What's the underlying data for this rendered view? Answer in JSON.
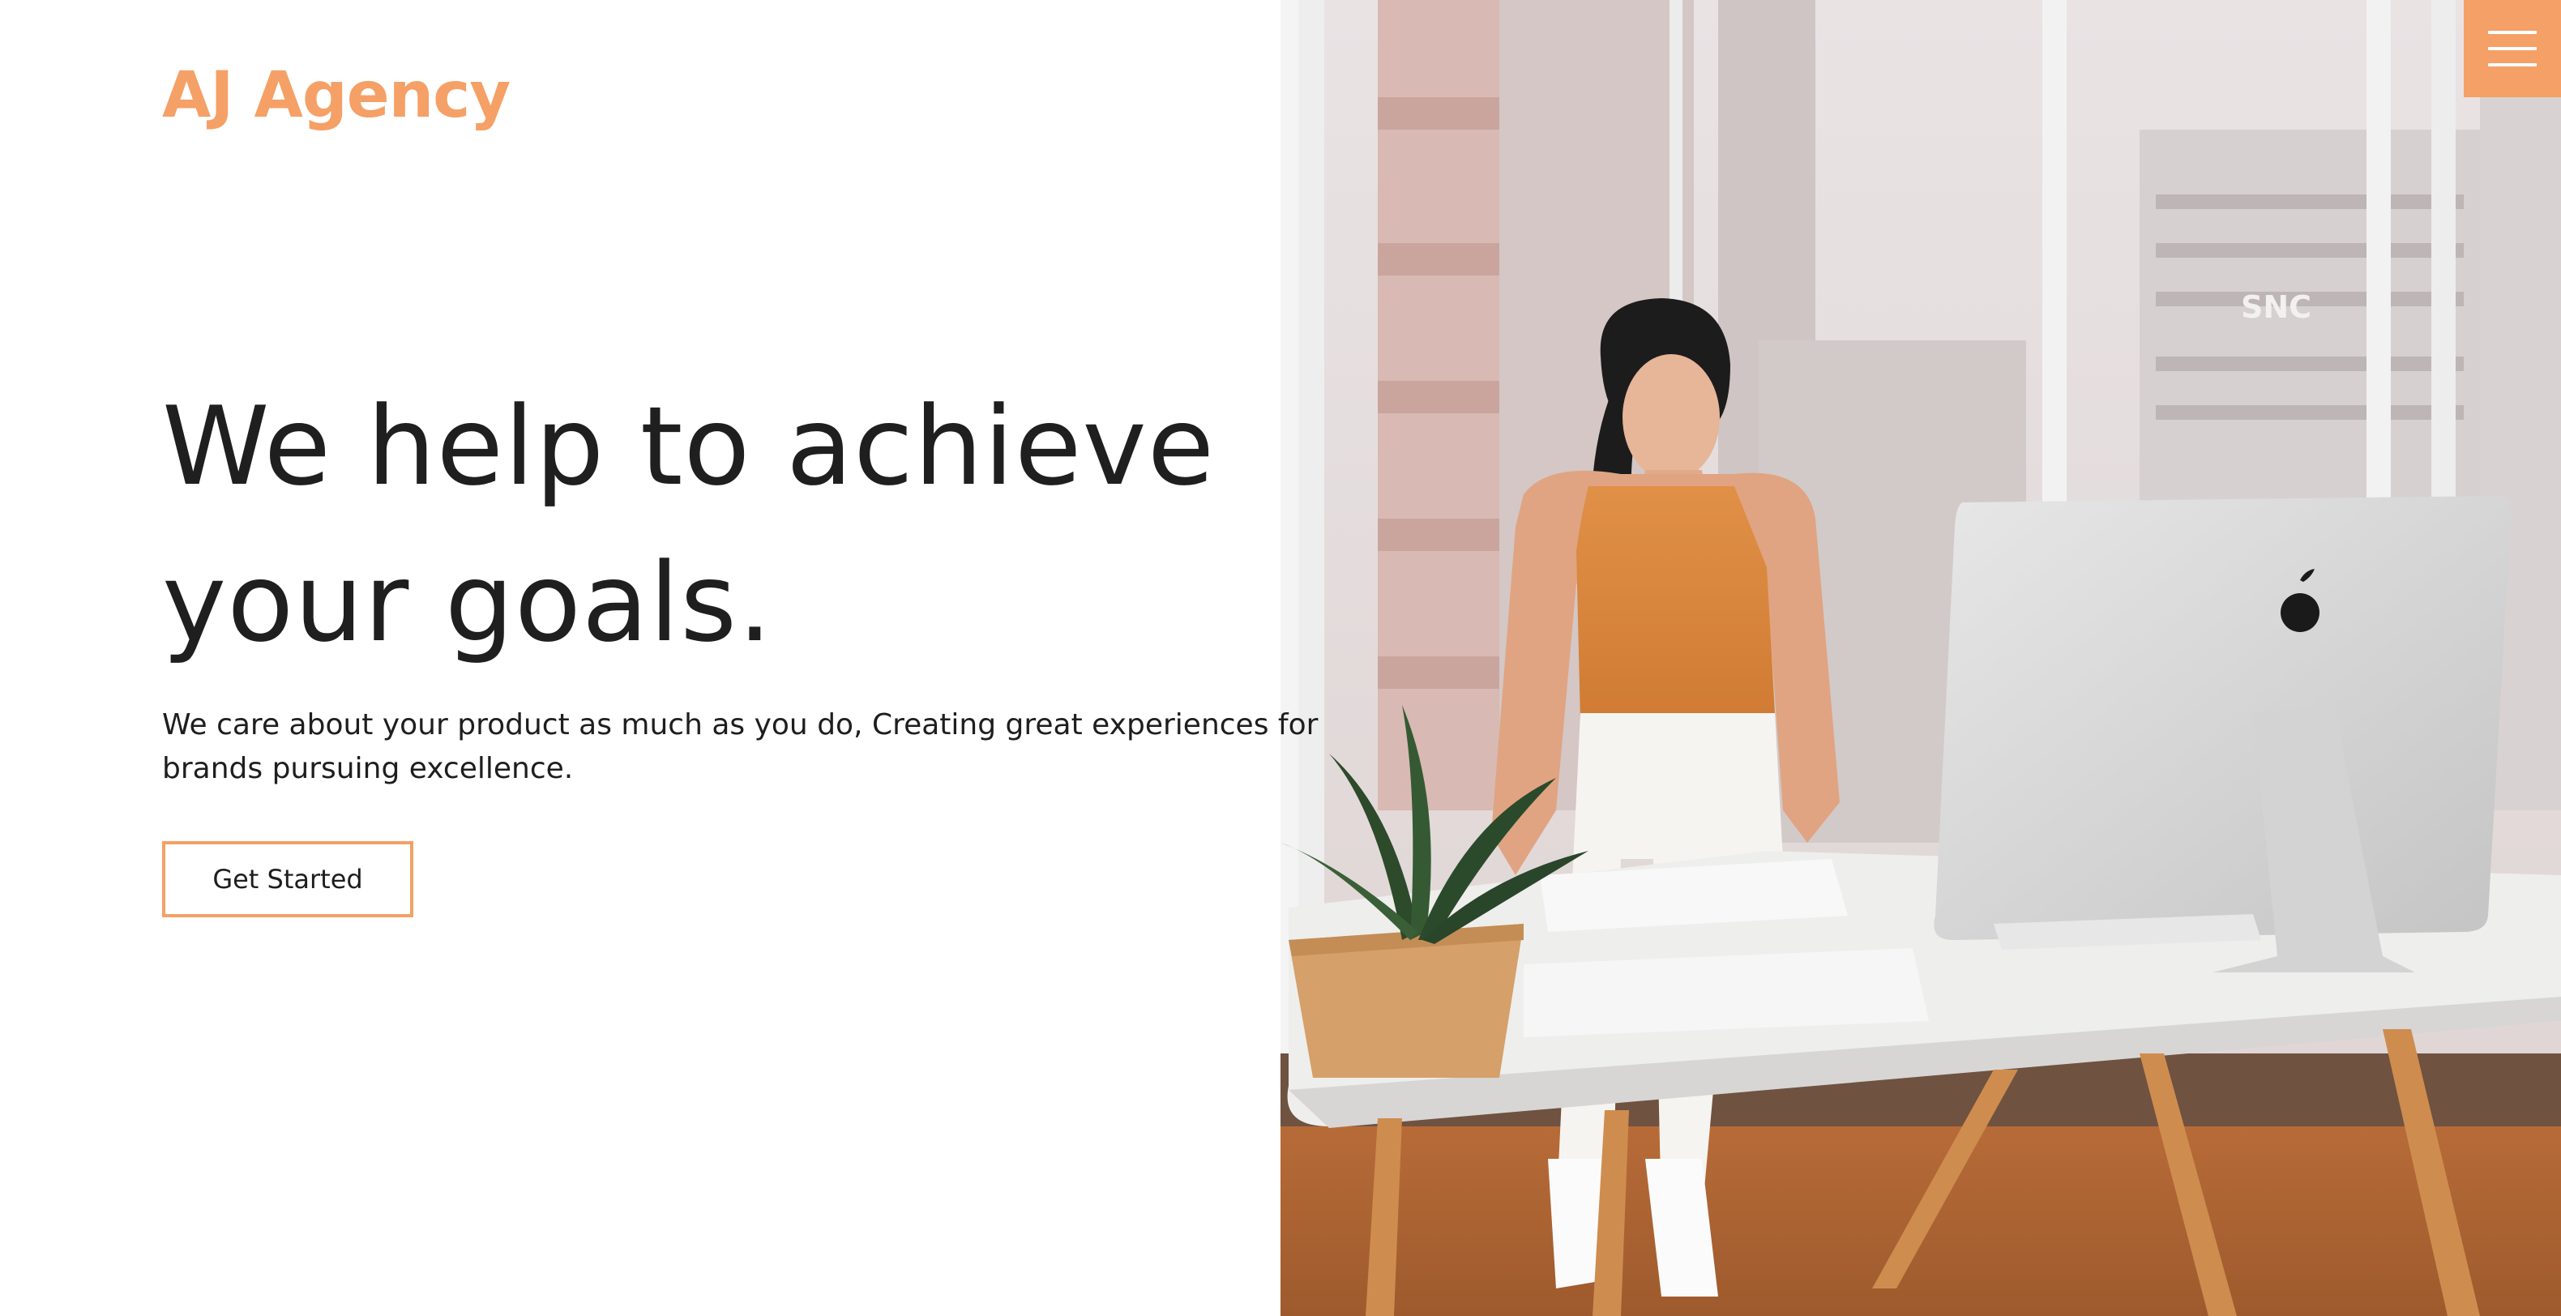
{
  "brand": {
    "name": "AJ Agency",
    "accent_color": "#f5a066"
  },
  "hero": {
    "headline_line1": "We help to achieve",
    "headline_line2": "your goals.",
    "subtext_line1": "We care about your product as much as you do, Creating great experiences for",
    "subtext_line2": "brands pursuing excellence.",
    "cta_label": "Get Started"
  },
  "header": {
    "menu_icon": "hamburger-icon",
    "menu_bg_color": "#f5a066"
  },
  "image": {
    "subject": "woman-working-at-desk-photo",
    "sign_text": "SNC"
  }
}
